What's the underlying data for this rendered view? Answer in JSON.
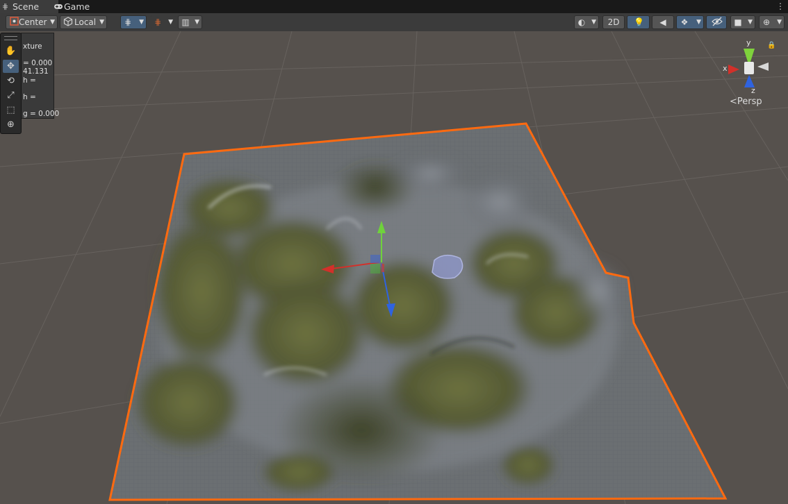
{
  "tabs": [
    {
      "label": "Scene",
      "icon": "grid-icon"
    },
    {
      "label": "Game",
      "icon": "gamepad-icon"
    }
  ],
  "toolbar": {
    "pivot_mode": "Center",
    "pivot_rotation": "Local",
    "mode_2d": "2D"
  },
  "tools": [
    "hand-tool",
    "move-tool",
    "rotate-tool",
    "scale-tool",
    "rect-tool",
    "transform-tool"
  ],
  "overlay_panel": {
    "line1": "xture",
    "line2": "= 0.000",
    "line3": "41.131",
    "line4": "h =",
    "line5": "h =",
    "line6": "g = 0.000"
  },
  "gizmo": {
    "axis_x": "x",
    "axis_y": "y",
    "axis_z": "z",
    "projection": "Persp"
  },
  "colors": {
    "selection_outline": "#ff6a10",
    "axis_x": "#d2302a",
    "axis_y": "#6fd13c",
    "axis_z": "#2f63e0",
    "active_button": "#46607c"
  }
}
